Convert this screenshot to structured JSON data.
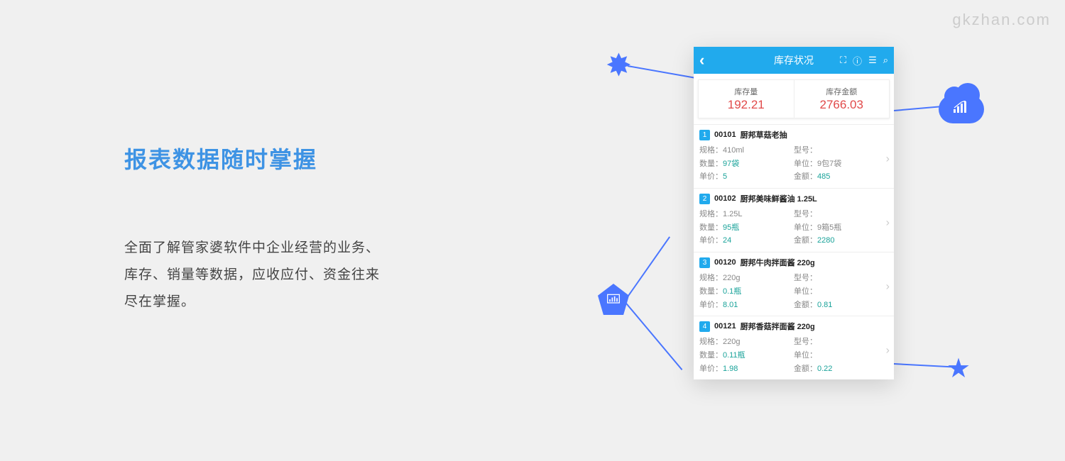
{
  "watermark": "gkzhan.com",
  "headline": "报表数据随时掌握",
  "desc_line1": "全面了解管家婆软件中企业经营的业务、",
  "desc_line2": "库存、销量等数据，应收应付、资金往来",
  "desc_line3": "尽在掌握。",
  "phone": {
    "title": "库存状况",
    "icons": {
      "scan": "scan-icon",
      "info": "info-icon",
      "list": "list-icon",
      "search": "search-icon"
    },
    "summary": {
      "stock_label": "库存量",
      "stock_value": "192.21",
      "amount_label": "库存金额",
      "amount_value": "2766.03"
    },
    "labels": {
      "spec": "规格：",
      "model": "型号：",
      "qty": "数量：",
      "unit": "单位：",
      "price": "单价：",
      "amount": "金额："
    },
    "items": [
      {
        "idx": "1",
        "code": "00101",
        "name": "厨邦草菇老抽",
        "spec": "410ml",
        "model": "",
        "qty": "97袋",
        "unit": "9包7袋",
        "price": "5",
        "amount": "485"
      },
      {
        "idx": "2",
        "code": "00102",
        "name": "厨邦美味鲜酱油 1.25L",
        "spec": "1.25L",
        "model": "",
        "qty": "95瓶",
        "unit": "9箱5瓶",
        "price": "24",
        "amount": "2280"
      },
      {
        "idx": "3",
        "code": "00120",
        "name": "厨邦牛肉拌面酱 220g",
        "spec": "220g",
        "model": "",
        "qty": "0.1瓶",
        "unit": "",
        "price": "8.01",
        "amount": "0.81"
      },
      {
        "idx": "4",
        "code": "00121",
        "name": "厨邦香菇拌面酱 220g",
        "spec": "220g",
        "model": "",
        "qty": "0.11瓶",
        "unit": "",
        "price": "1.98",
        "amount": "0.22"
      }
    ]
  }
}
